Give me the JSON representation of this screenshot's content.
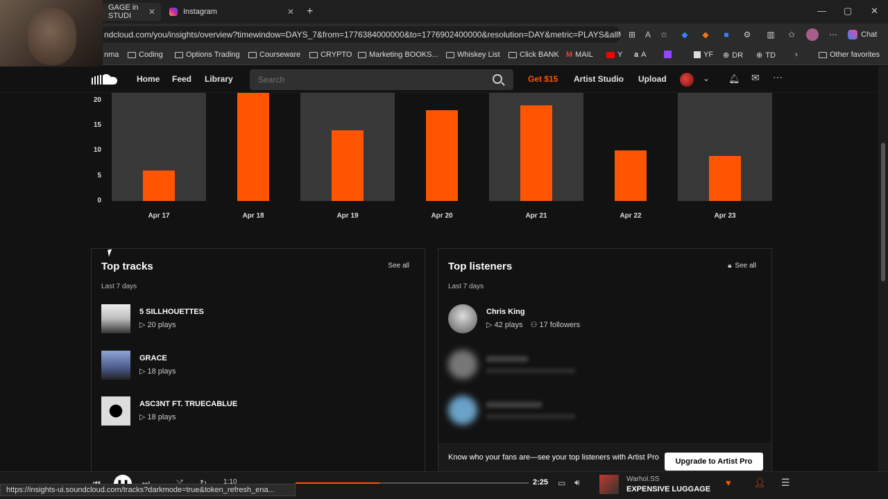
{
  "browser": {
    "tabs": [
      {
        "label": "GAGE in STUDI",
        "active": true
      },
      {
        "label": "Instagram",
        "active": false
      }
    ],
    "new_tab_icon": "plus-icon",
    "url": "ndcloud.com/you/insights/overview?timewindow=DAYS_7&from=1776384000000&to=1776902400000&resolution=DAY&metric=PLAYS&allM...",
    "chat_label": "Chat",
    "bookmarks": [
      "nma",
      "Coding",
      "Options Trading",
      "Courseware",
      "CRYPTO",
      "Marketing BOOKS...",
      "Whiskey List",
      "Click BANK",
      "MAIL",
      "Y",
      "A",
      "",
      "YF",
      "DR",
      "TD",
      "Other favorites"
    ],
    "status_url": "https://insights-ui.soundcloud.com/tracks?darkmode=true&token_refresh_ena..."
  },
  "header": {
    "nav": {
      "home": "Home",
      "feed": "Feed",
      "library": "Library"
    },
    "search_placeholder": "Search",
    "get_offer": "Get $15",
    "artist_studio": "Artist Studio",
    "upload": "Upload",
    "accent": "#ff5500"
  },
  "chart_data": {
    "type": "bar",
    "categories": [
      "Apr 17",
      "Apr 18",
      "Apr 19",
      "Apr 20",
      "Apr 21",
      "Apr 22",
      "Apr 23"
    ],
    "values": [
      6,
      22,
      14,
      18,
      19,
      10,
      9
    ],
    "ylim": [
      0,
      21.5
    ],
    "yticks": [
      0,
      5,
      10,
      15,
      20
    ],
    "bar_color": "#ff5500",
    "column_color": "#383838",
    "grid": false
  },
  "top_tracks": {
    "title": "Top tracks",
    "see_all": "See all",
    "subtitle": "Last 7 days",
    "items": [
      {
        "title": "5 SILLHOUETTES",
        "plays": "20 plays"
      },
      {
        "title": "GRACE",
        "plays": "18 plays"
      },
      {
        "title": "ASC3NT FT. TRUECABLUE",
        "plays": "18 plays"
      }
    ]
  },
  "top_listeners": {
    "title": "Top listeners",
    "see_all": "See all",
    "subtitle": "Last 7 days",
    "items": [
      {
        "name": "Chris King",
        "plays": "42 plays",
        "followers": "17 followers"
      }
    ],
    "upsell_text": "Know who your fans are—see your top listeners with Artist Pro",
    "upsell_button": "Upgrade to Artist Pro"
  },
  "player": {
    "time": "2:25",
    "elapsed": "1:10",
    "progress": 0.36,
    "artist": "Warhol.SS",
    "track": "EXPENSIVE LUGGAGE"
  }
}
